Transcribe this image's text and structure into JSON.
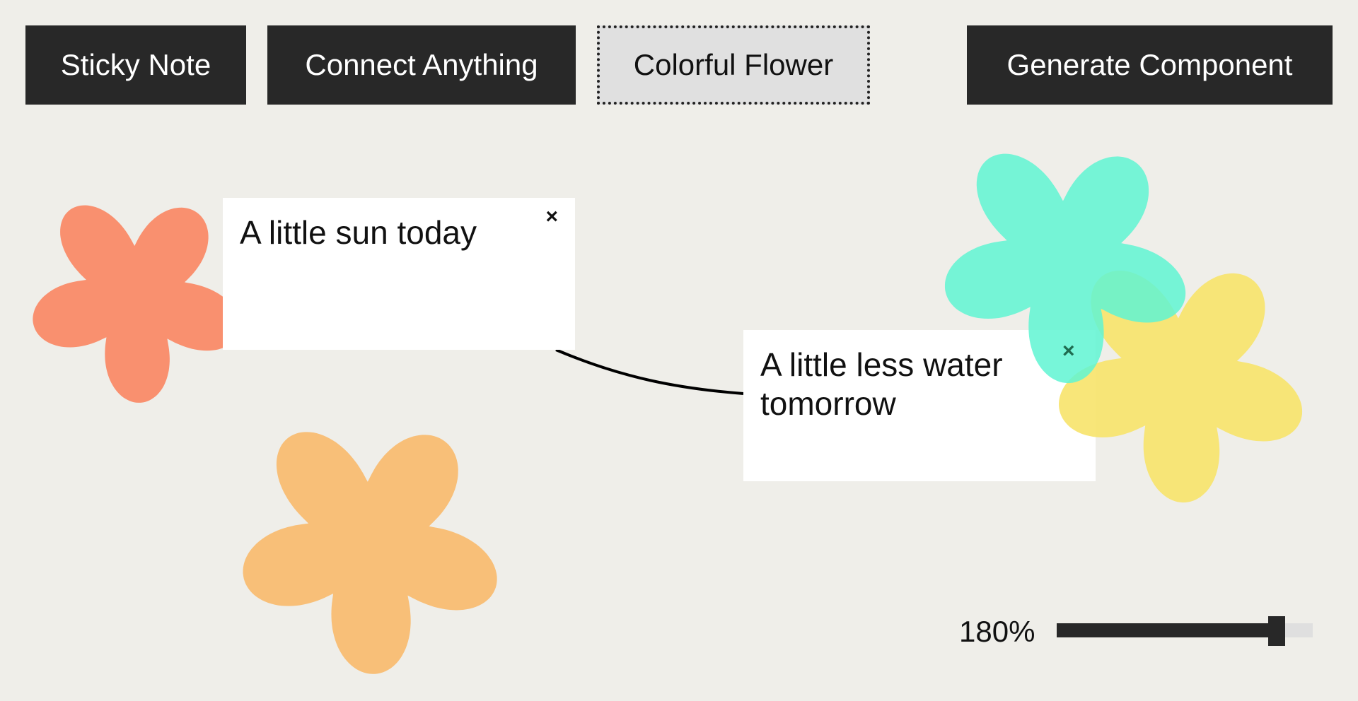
{
  "toolbar": {
    "sticky_note_label": "Sticky Note",
    "connect_label": "Connect Anything",
    "flower_label": "Colorful Flower",
    "generate_label": "Generate Component",
    "active_tool": "Colorful Flower"
  },
  "notes": [
    {
      "text": "A little sun today",
      "close_icon": "×"
    },
    {
      "text": "A little less water tomorrow",
      "close_icon": "×"
    }
  ],
  "flowers": [
    {
      "color": "#f9906f",
      "opacity": 1
    },
    {
      "color": "#f8bf78",
      "opacity": 1
    },
    {
      "color": "#5ff5d2",
      "opacity": 0.85
    },
    {
      "color": "#f7e36a",
      "opacity": 0.9
    }
  ],
  "connector": {
    "color": "#000000"
  },
  "zoom": {
    "label": "180%",
    "fraction": 0.86
  },
  "colors": {
    "background": "#efeee9",
    "button_dark": "#282828",
    "button_active": "#e0e0e0"
  }
}
